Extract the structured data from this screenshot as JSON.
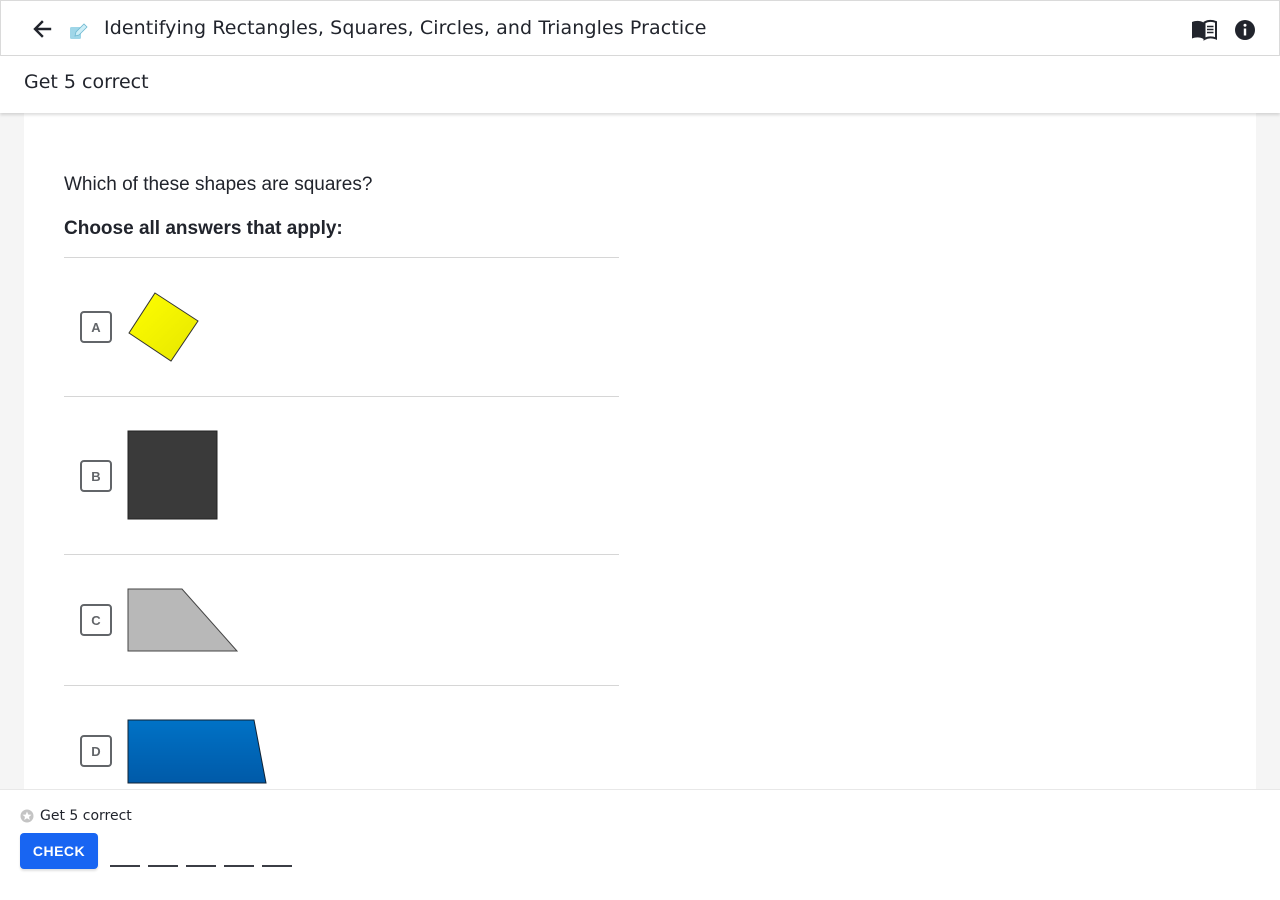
{
  "header": {
    "title": "Identifying Rectangles, Squares, Circles, and Triangles Practice",
    "icons": {
      "back": "arrow-left-icon",
      "exercise": "pencil-exercise-icon",
      "hints": "book-icon",
      "info": "info-icon"
    }
  },
  "subheader": {
    "goal": "Get 5 correct"
  },
  "question": {
    "prompt": "Which of these shapes are squares?",
    "instruction": "Choose all answers that apply:",
    "choices": [
      {
        "letter": "A",
        "shape": "rotated-square",
        "color": "#ffff00"
      },
      {
        "letter": "B",
        "shape": "square",
        "color": "#3a3a3a"
      },
      {
        "letter": "C",
        "shape": "trapezoid",
        "color": "#b8b8b8"
      },
      {
        "letter": "D",
        "shape": "parallelogram",
        "color": "#0066bb"
      }
    ]
  },
  "footer": {
    "goal": "Get 5 correct",
    "check_label": "CHECK",
    "progress": {
      "answered": 0,
      "total": 5
    },
    "accent": "#1865f2"
  }
}
